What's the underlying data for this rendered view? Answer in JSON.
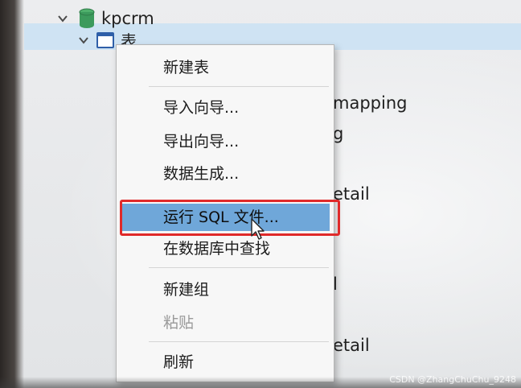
{
  "tree": {
    "db_name": "kpcrm",
    "tables_label": "表",
    "partial_items": [
      "mapping",
      "g",
      "etail",
      "l",
      "etail"
    ]
  },
  "context_menu": {
    "items": [
      {
        "label": "新建表",
        "state": "normal"
      },
      {
        "label": "导入向导...",
        "state": "normal"
      },
      {
        "label": "导出向导...",
        "state": "normal"
      },
      {
        "label": "数据生成...",
        "state": "normal"
      },
      {
        "label": "运行 SQL 文件...",
        "state": "highlighted"
      },
      {
        "label": "在数据库中查找",
        "state": "normal"
      },
      {
        "label": "新建组",
        "state": "normal"
      },
      {
        "label": "粘贴",
        "state": "disabled"
      },
      {
        "label": "刷新",
        "state": "normal"
      }
    ]
  },
  "watermark": "CSDN @ZhangChuChu_9248",
  "colors": {
    "highlight": "#6fa7d9",
    "annotation_box": "#e02a2a",
    "db_icon": "#3c9a5c",
    "selected_row": "#cfe3f3"
  }
}
